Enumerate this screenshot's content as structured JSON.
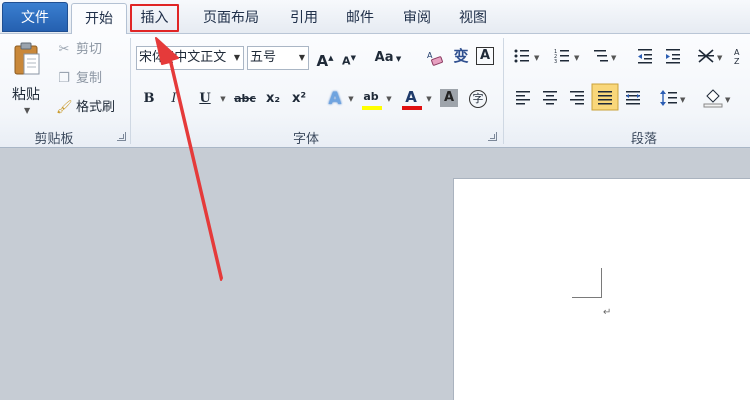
{
  "tabs": {
    "file": "文件",
    "home": "开始",
    "insert": "插入",
    "page_layout": "页面布局",
    "references": "引用",
    "mailings": "邮件",
    "review": "审阅",
    "view": "视图"
  },
  "clipboard": {
    "paste": "粘贴",
    "cut": "剪切",
    "copy": "复制",
    "format_painter": "格式刷",
    "group_label": "剪贴板"
  },
  "font": {
    "font_name": "宋体 (中文正文",
    "font_size": "五号",
    "grow_label": "A",
    "shrink_label": "A",
    "change_case_label": "Aa",
    "bold_label": "B",
    "italic_label": "I",
    "underline_label": "U",
    "strike_label": "abc",
    "subscript_label": "x₂",
    "superscript_label": "x²",
    "effects_label": "A",
    "highlight_label": "ab",
    "font_color_label": "A",
    "char_shading_label": "A",
    "enclose_label": "字",
    "phonetic_label": "变",
    "char_border_label": "A",
    "group_label": "字体",
    "highlight_color": "#ffff00",
    "font_color": "#e01010"
  },
  "paragraph": {
    "group_label": "段落"
  },
  "colors": {
    "annotation": "#e53a3a",
    "highlight_box": "#e02525"
  }
}
